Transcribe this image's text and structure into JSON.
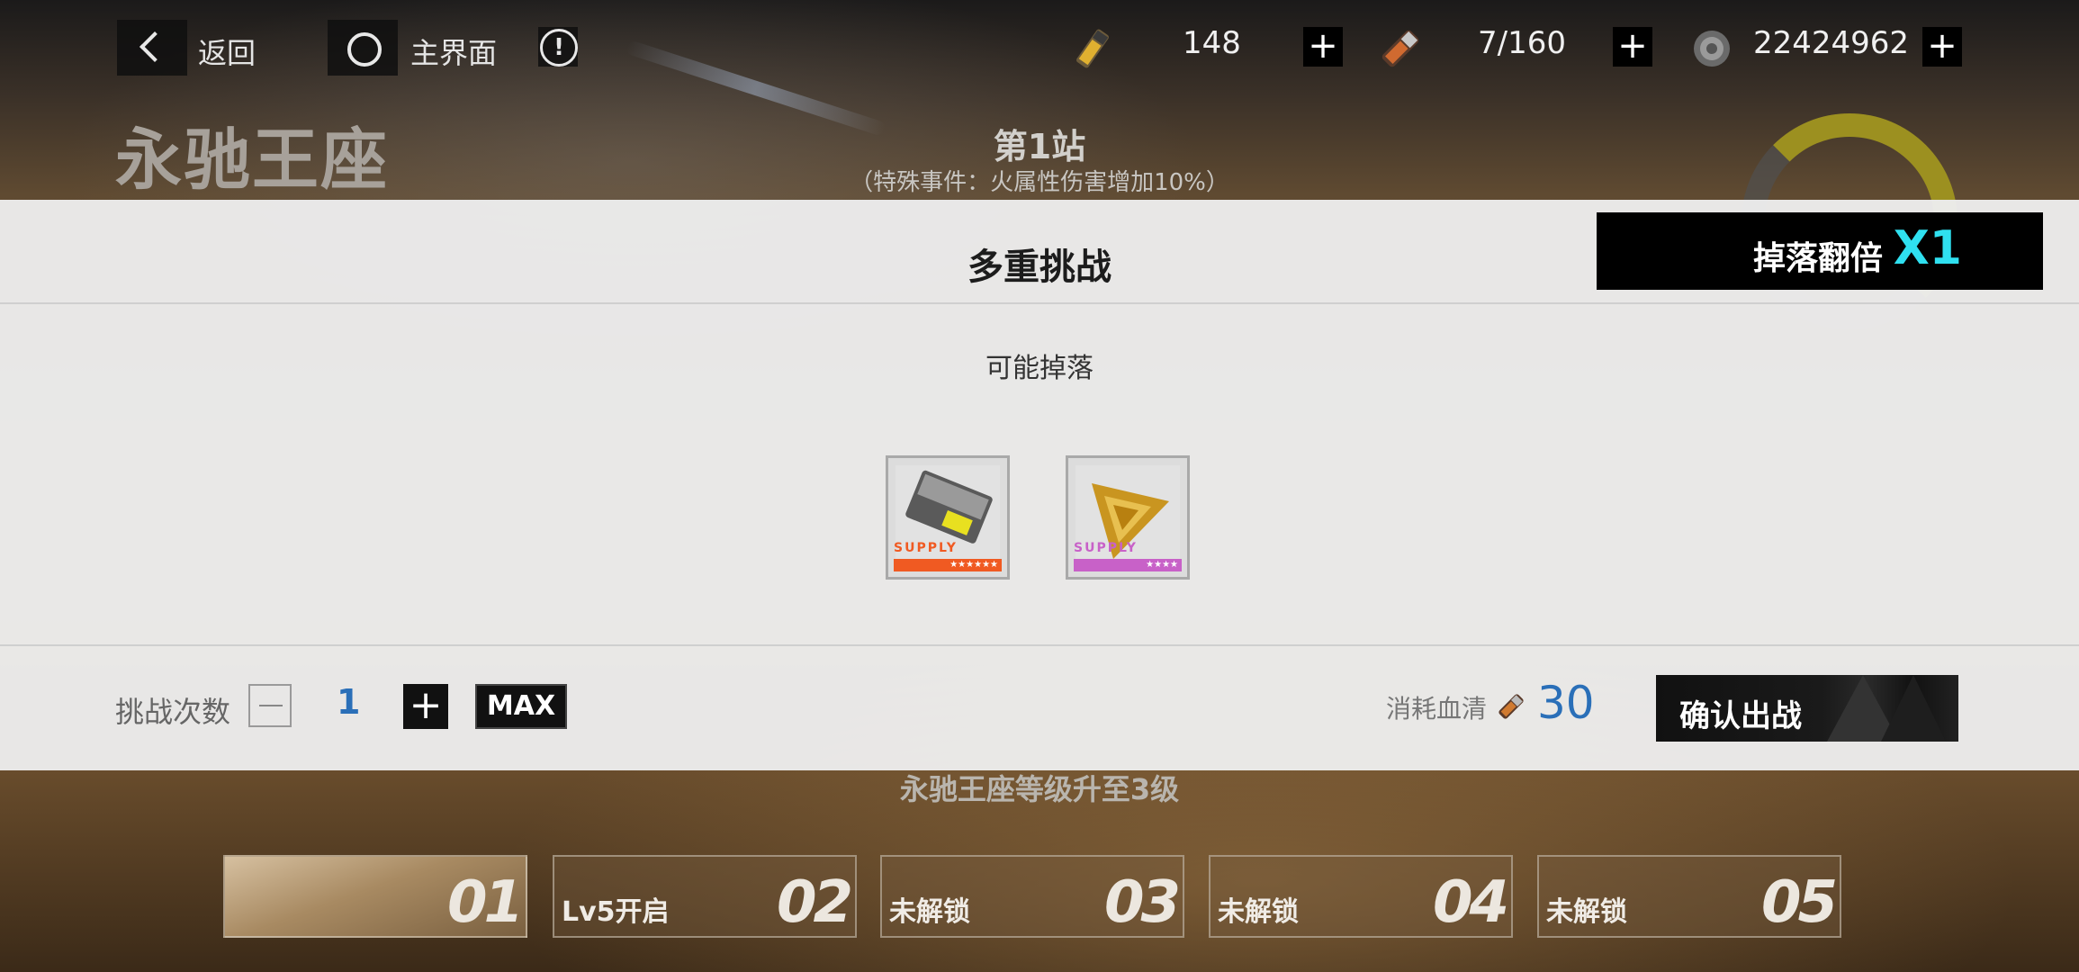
{
  "topbar": {
    "back_label": "返回",
    "home_label": "主界面",
    "resources": [
      {
        "name": "stamina",
        "value": "148"
      },
      {
        "name": "serum",
        "value": "7/160"
      },
      {
        "name": "currency",
        "value": "22424962"
      }
    ]
  },
  "event": {
    "title": "永驰王座",
    "station": "第1站",
    "station_event": "（特殊事件：火属性伤害增加10%）",
    "upgrade_hint": "永驰王座等级升至3级"
  },
  "modal": {
    "title": "多重挑战",
    "drop_bonus_label": "掉落翻倍",
    "drop_bonus_value": "X1",
    "possible_drops_label": "可能掉落",
    "items": [
      {
        "name": "supply-card",
        "tag": "SUPPLY",
        "rarity": "★★★★★★",
        "rarity_color": "#f05a22"
      },
      {
        "name": "supply-badge",
        "tag": "SUPPLY",
        "rarity": "★★★★",
        "rarity_color": "#c861c8"
      }
    ],
    "challenge_count_label": "挑战次数",
    "challenge_count": "1",
    "max_label": "MAX",
    "cost_label": "消耗血清",
    "cost_value": "30",
    "confirm_label": "确认出战"
  },
  "stages": [
    {
      "label": "",
      "number": "01"
    },
    {
      "label": "Lv5开启",
      "number": "02"
    },
    {
      "label": "未解锁",
      "number": "03"
    },
    {
      "label": "未解锁",
      "number": "04"
    },
    {
      "label": "未解锁",
      "number": "05"
    }
  ],
  "colors": {
    "accent_blue": "#2a6fb8",
    "drop_cyan": "#2fe0f0"
  }
}
